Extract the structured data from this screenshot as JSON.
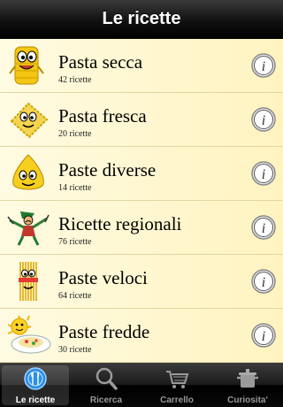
{
  "navbar": {
    "title": "Le ricette"
  },
  "recipes": [
    {
      "title": "Pasta secca",
      "count": "42 ricette",
      "icon": "rigatoni-mascot-icon"
    },
    {
      "title": "Pasta fresca",
      "count": "20 ricette",
      "icon": "ravioli-mascot-icon"
    },
    {
      "title": "Paste diverse",
      "count": "14 ricette",
      "icon": "gnocco-mascot-icon"
    },
    {
      "title": "Ricette regionali",
      "count": "76 ricette",
      "icon": "regional-character-icon"
    },
    {
      "title": "Paste veloci",
      "count": "64 ricette",
      "icon": "spaghetti-mascot-icon"
    },
    {
      "title": "Paste fredde",
      "count": "30 ricette",
      "icon": "cold-pasta-plate-icon"
    }
  ],
  "tabs": [
    {
      "label": "Le ricette",
      "icon": "plate-cutlery-icon",
      "active": true
    },
    {
      "label": "Ricerca",
      "icon": "magnifier-icon",
      "active": false
    },
    {
      "label": "Carrello",
      "icon": "cart-icon",
      "active": false
    },
    {
      "label": "Curiosita'",
      "icon": "pot-icon",
      "active": false
    }
  ],
  "colors": {
    "list_bg": "#fff5c8",
    "bar_dark": "#111111",
    "pasta_yellow": "#f2c40f"
  }
}
